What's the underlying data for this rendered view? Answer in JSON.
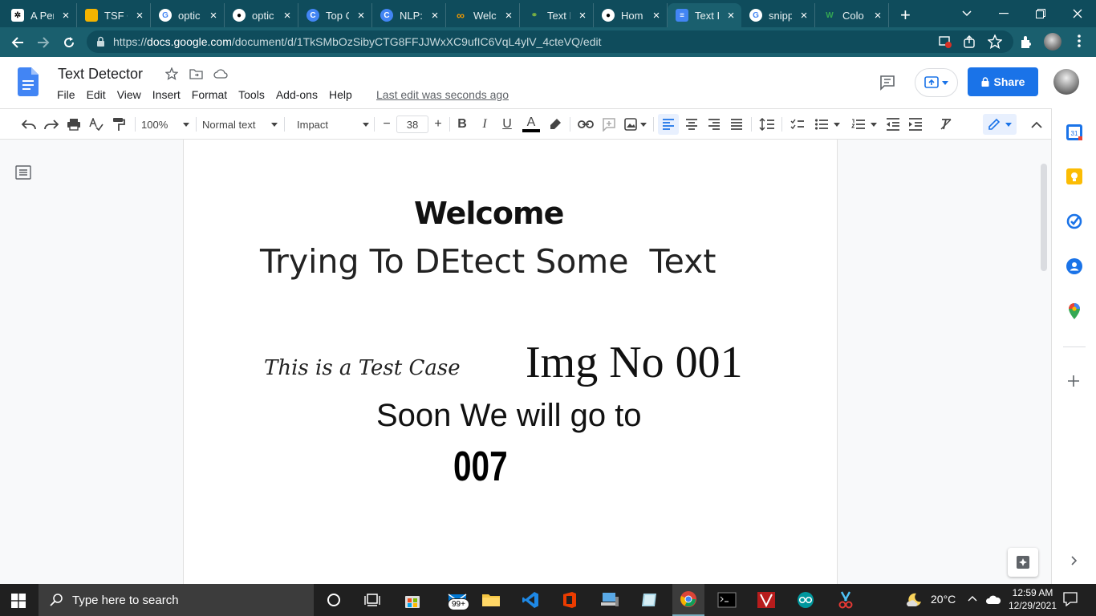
{
  "browser": {
    "tabs": [
      {
        "title": "A Per",
        "icon": "openai-icon",
        "color": "#ffffff"
      },
      {
        "title": "TSF C",
        "icon": "slides-icon",
        "color": "#f4b400"
      },
      {
        "title": "optic",
        "icon": "google-icon",
        "color": "#ffffff"
      },
      {
        "title": "optic",
        "icon": "github-icon",
        "color": "#ffffff"
      },
      {
        "title": "Top C",
        "icon": "c-icon",
        "color": "#4285f4"
      },
      {
        "title": "NLP:",
        "icon": "c-icon",
        "color": "#4285f4"
      },
      {
        "title": "Welc",
        "icon": "infinity-icon",
        "color": "#f29900"
      },
      {
        "title": "Text I",
        "icon": "link-icon",
        "color": "#7cb342"
      },
      {
        "title": "Hom",
        "icon": "github-icon",
        "color": "#ffffff"
      },
      {
        "title": "Text I",
        "icon": "docs-icon",
        "color": "#4285f4",
        "active": true
      },
      {
        "title": "snipp",
        "icon": "google-icon",
        "color": "#ffffff"
      },
      {
        "title": "Colo",
        "icon": "w-icon",
        "color": "#34a853"
      }
    ],
    "new_tab": "+",
    "url_scheme": "https://",
    "url_host": "docs.google.com",
    "url_path": "/document/d/1TkSMbOzSibyCTG8FFJJWxXC9ufIC6VqL4ylV_4cteVQ/edit"
  },
  "docs": {
    "title": "Text Detector",
    "menu": [
      "File",
      "Edit",
      "View",
      "Insert",
      "Format",
      "Tools",
      "Add-ons",
      "Help"
    ],
    "last_edit": "Last edit was seconds ago",
    "share_label": "Share"
  },
  "toolbar": {
    "zoom": "100%",
    "style": "Normal text",
    "font": "Impact",
    "font_size": "38",
    "minus": "−",
    "plus": "+"
  },
  "document": {
    "line1": "Welcome",
    "line2": "Trying To DEtect Some  Text",
    "line3a": "This is a Test Case",
    "line3b": "Img No 001",
    "line4": "Soon We will go to",
    "line5": "007"
  },
  "taskbar": {
    "search_placeholder": "Type here to search",
    "temperature": "20°C",
    "time": "12:59 AM",
    "date": "12/29/2021",
    "mail_badge": "99+"
  },
  "colors": {
    "tab_bg": "#0f4c5c",
    "active_tab": "#1a5f6e",
    "share_blue": "#1a73e8"
  }
}
